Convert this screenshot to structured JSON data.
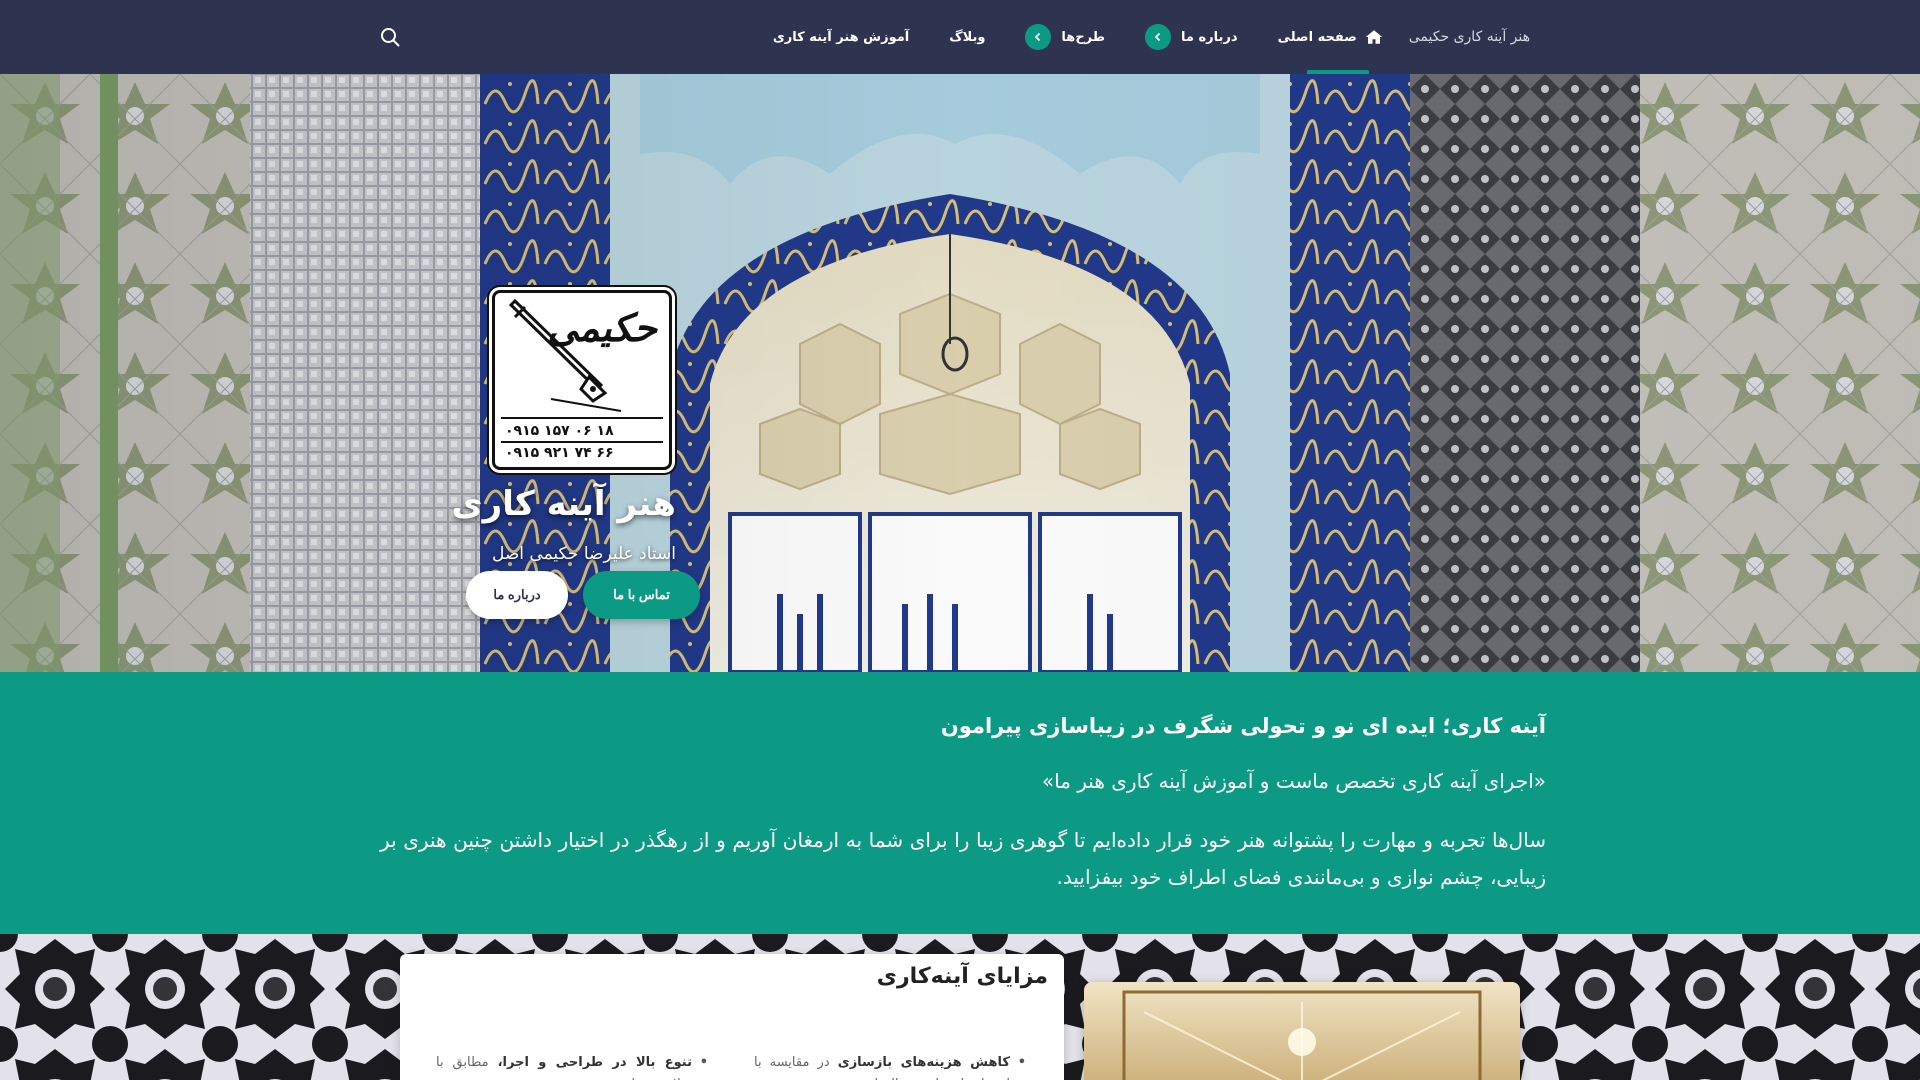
{
  "nav": {
    "brand": "هنر آینه کاری حکیمی",
    "items": [
      {
        "label": "صفحه اصلی",
        "icon": "home-icon",
        "active": true
      },
      {
        "label": "درباره ما",
        "icon": "chevron-left-icon"
      },
      {
        "label": "طرح‌ها",
        "icon": "chevron-left-icon"
      },
      {
        "label": "وبلاگ"
      },
      {
        "label": "آموزش هنر آینه کاری"
      }
    ],
    "search_icon": "search-icon",
    "colors": {
      "background": "#2e3450",
      "accent": "#0c9a85"
    }
  },
  "hero": {
    "logo": {
      "brand_text": "حکیمی",
      "phone_1": "۰۹۱۵ ۱۵۷ ۰۶ ۱۸",
      "phone_2": "۰۹۱۵ ۹۲۱ ۷۴ ۶۶"
    },
    "title": "هنر آینه کاری",
    "subtitle": "استاد علیرضا حکیمی اصل",
    "buttons": {
      "contact": "تماس با ما",
      "about": "درباره ما"
    }
  },
  "intro": {
    "heading": "آینه کاری؛ ایده ای نو و تحولی شگرف در زیباسازی پیرامون",
    "quote": "«اجرای آینه کاری تخصص ماست و آموزش آینه کاری هنر ما»",
    "body": "سال‌ها تجربه و مهارت را پشتوانه هنر خود قرار داده‌ایم تا گوهری زیبا را برای شما به ارمغان آوریم و از رهگذر در اختیار داشتن چنین هنری بر زیبایی، چشم نوازی و بی‌مانندی فضای اطراف خود بیفزایید.",
    "color": "#0c9a85"
  },
  "features": {
    "title": "مزایای آینه‌کاری",
    "items": [
      {
        "bold": "کاهش هزینه‌های بازسازی",
        "text": " در مقایسه با استفاده از سایر متریال‌ها"
      },
      {
        "bold": "تنوع بالا در طراحی و اجرا،",
        "text": " مطابق با سلایق مختلف"
      }
    ]
  }
}
